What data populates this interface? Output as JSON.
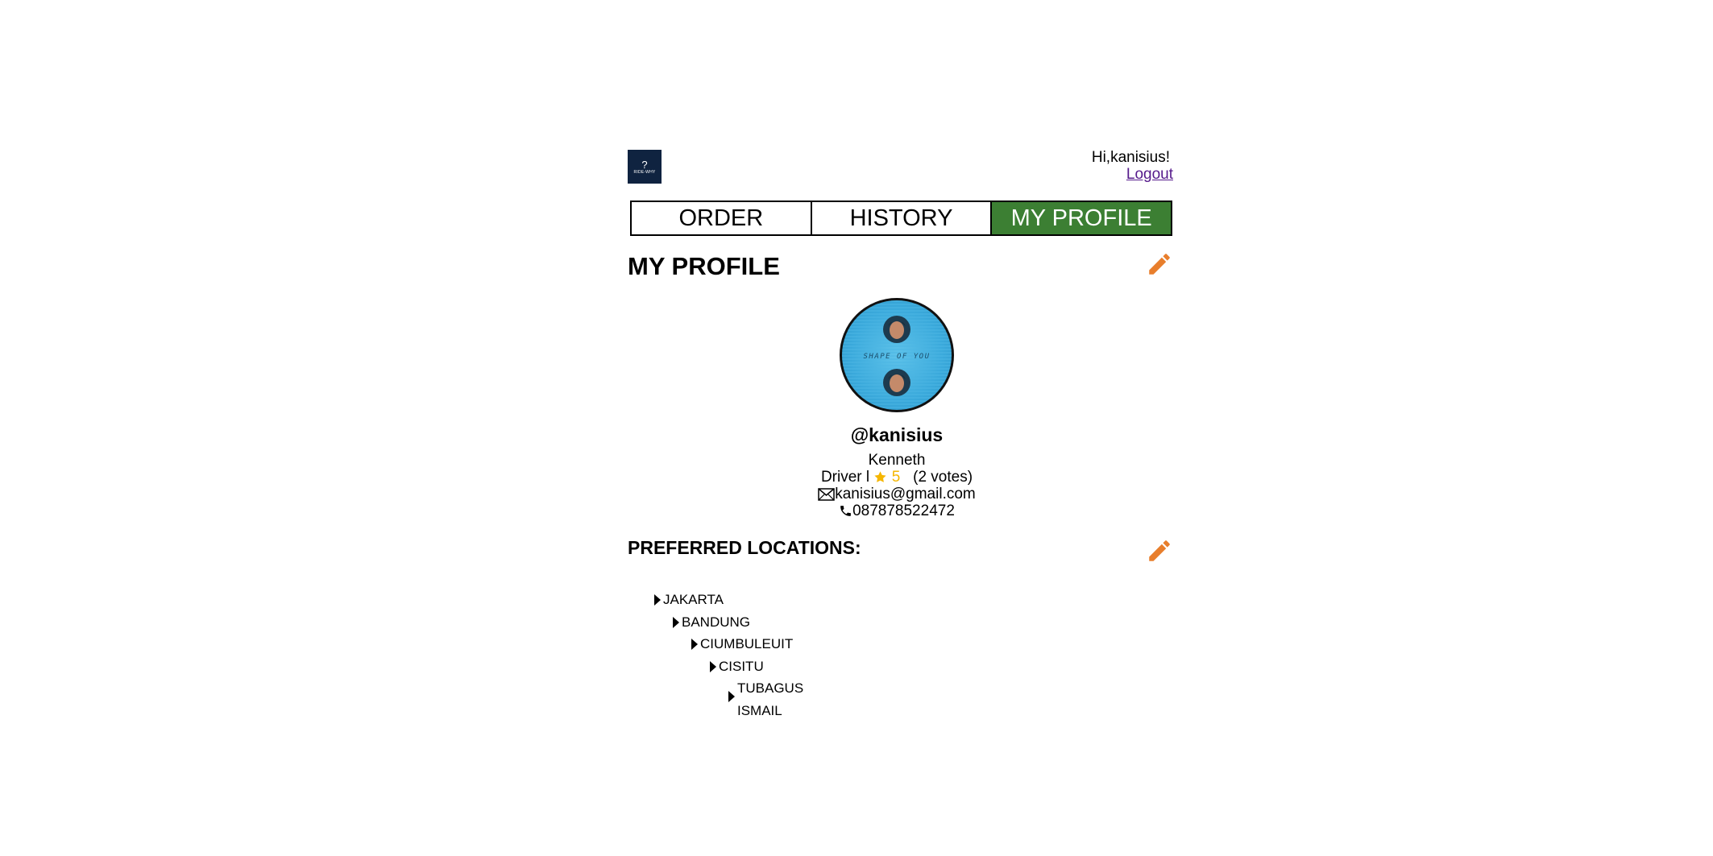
{
  "header": {
    "logo_symbol": "?",
    "logo_text": "RIDE-WHY",
    "greeting": "Hi,kanisius!",
    "logout_label": "Logout"
  },
  "tabs": [
    {
      "label": "ORDER",
      "active": false
    },
    {
      "label": "HISTORY",
      "active": false
    },
    {
      "label": "MY PROFILE",
      "active": true
    }
  ],
  "profile": {
    "title": "MY PROFILE",
    "username": "@kanisius",
    "full_name": "Kenneth",
    "role": "Driver",
    "separator": "l",
    "rating": "5",
    "votes": "(2 votes)",
    "email": "kanisius@gmail.com",
    "phone": "087878522472",
    "avatar_caption": "SHAPE OF YOU"
  },
  "locations": {
    "title": "PREFERRED LOCATIONS:",
    "items": [
      {
        "name": "JAKARTA"
      },
      {
        "name": "BANDUNG"
      },
      {
        "name": "CIUMBULEUIT"
      },
      {
        "name": "CISITU"
      },
      {
        "name_line1": "TUBAGUS",
        "name_line2": "ISMAIL"
      }
    ]
  },
  "colors": {
    "active_tab": "#3c7f33",
    "edit_icon": "#e87e2c",
    "star": "#f5b600",
    "logo_bg": "#0f2340",
    "link": "#551a8b"
  },
  "icons": {
    "edit": "pencil-icon",
    "email": "envelope-icon",
    "phone": "phone-icon",
    "rating": "star-icon",
    "tree": "triangle-right-icon"
  }
}
